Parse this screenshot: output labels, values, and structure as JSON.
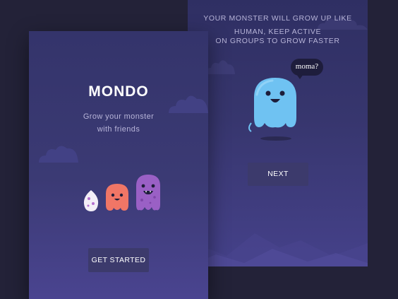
{
  "welcome_screen": {
    "title": "MONDO",
    "subtitle_line1": "Grow your monster",
    "subtitle_line2": "with friends",
    "cta_label": "GET STARTED",
    "characters": [
      "egg-icon",
      "orange-monster-icon",
      "purple-monster-icon"
    ]
  },
  "info_screen": {
    "text_line1": "YOUR MONSTER WILL GROW UP LIKE",
    "text_line2": "HUMAN, KEEP ACTIVE",
    "text_line3": "ON GROUPS TO GROW FASTER",
    "speech_bubble": "moma?",
    "next_label": "NEXT",
    "character": "blue-monster-icon"
  },
  "colors": {
    "page_background": "#232238",
    "screen_top": "#34346b",
    "screen_bottom": "#4a4490",
    "button_background": "#3c3a6c",
    "blue_monster": "#6fc2f2",
    "orange_monster": "#f07666",
    "purple_monster": "#9a60c5",
    "egg": "#f3eef7"
  }
}
